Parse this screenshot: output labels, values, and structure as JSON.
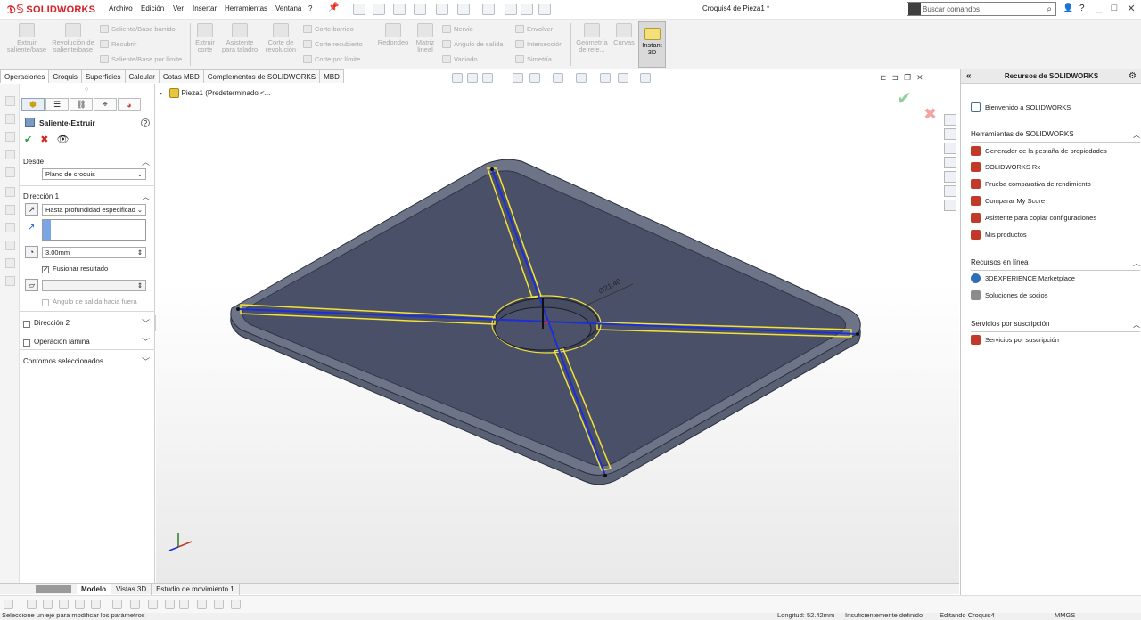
{
  "app": {
    "brand": "SOLIDWORKS",
    "document_title": "Croquis4 de Pieza1 *",
    "menus": [
      "Archivo",
      "Edición",
      "Ver",
      "Insertar",
      "Herramientas",
      "Ventana",
      "?"
    ],
    "search_placeholder": "Buscar comandos",
    "window_buttons": [
      "_",
      "□",
      "✕"
    ],
    "brand_color": "#d81f26"
  },
  "ribbon": {
    "extruir": "Extruir saliente/base",
    "revolucion": "Revolución de saliente/base",
    "barrido": "Saliente/Base barrido",
    "recubrir": "Recubrir",
    "limite": "Saliente/Base por límite",
    "extruir_corte": "Extruir corte",
    "asistente_taladro": "Asistente para taladro",
    "corte_revolucion": "Corte de revolución",
    "corte_barrido": "Corte barrido",
    "corte_recubierto": "Corte recubierto",
    "corte_limite": "Corte por límite",
    "redondeo": "Redondeo",
    "matriz": "Matriz lineal",
    "nervio": "Nervio",
    "angulo_salida": "Ángulo de salida",
    "vaciado": "Vaciado",
    "envolver": "Envolver",
    "interseccion": "Intersección",
    "simetria": "Simetría",
    "geometria": "Geometría de refe...",
    "curvas": "Curvas",
    "instant3d": "Instant 3D"
  },
  "command_tabs": [
    "Operaciones",
    "Croquis",
    "Superficies",
    "Calcular",
    "Cotas MBD",
    "Complementos de SOLIDWORKS",
    "MBD"
  ],
  "property_manager": {
    "title": "Saliente-Extruir",
    "desde_label": "Desde",
    "desde_value": "Plano de croquis",
    "direccion1_label": "Dirección 1",
    "end_condition": "Hasta profundidad especificada",
    "depth_value": "3.00mm",
    "merge_result_label": "Fusionar resultado",
    "merge_result_checked": true,
    "draft_outward_label": "Ángulo de salida hacia fuera",
    "direccion2_label": "Dirección 2",
    "thin_feature_label": "Operación lámina",
    "selected_contours_label": "Contornos seleccionados"
  },
  "feature_tree": {
    "root": "Pieza1  (Predeterminado <..."
  },
  "graphics": {
    "dimension_text": "∅21.40",
    "model_face_color": "#4a5068",
    "model_edge_color": "#2a2f3c",
    "sketch_yellow": "#f2e23c",
    "sketch_blue": "#1c2fd6"
  },
  "task_pane": {
    "title": "Recursos de SOLIDWORKS",
    "welcome": "Bienvenido a SOLIDWORKS",
    "tools_section": "Herramientas de SOLIDWORKS",
    "tools": [
      "Generador de la pestaña de propiedades",
      "SOLIDWORKS Rx",
      "Prueba comparativa de rendimiento",
      "Comparar My Score",
      "Asistente para copiar configuraciones",
      "Mis productos"
    ],
    "online_section": "Recursos en línea",
    "online": [
      "3DEXPERIENCE Marketplace",
      "Soluciones de socios"
    ],
    "subscription_section": "Servicios por suscripción",
    "subscription": [
      "Servicios por suscripción"
    ]
  },
  "bottom_tabs": [
    "Modelo",
    "Vistas 3D",
    "Estudio de movimiento 1"
  ],
  "status_bar": {
    "message": "Seleccione un eje para modificar los parámetros",
    "length": "Longitud: 52.42mm",
    "definition": "Insuficientemente definido",
    "editing": "Editando Croquis4",
    "units": "MMGS"
  }
}
